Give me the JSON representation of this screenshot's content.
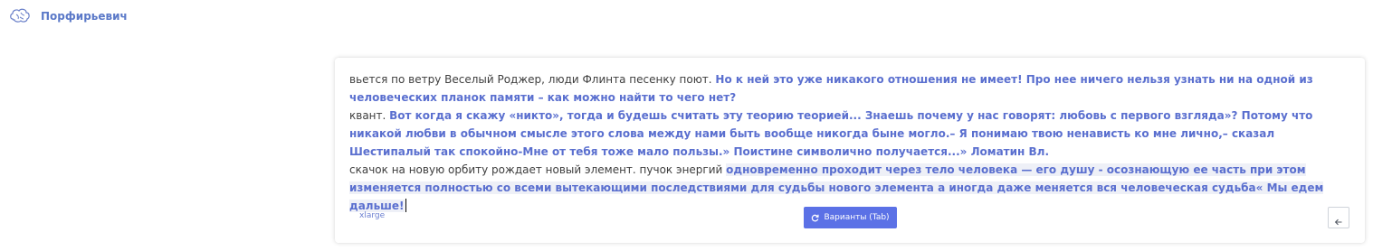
{
  "header": {
    "logo_icon": "brain-icon",
    "title": "Порфирьевич"
  },
  "editor": {
    "paragraphs": [
      {
        "prompt": "вьется по ветру Веселый Роджер, люди Флинта песенку поют. ",
        "generated": "Но к ней это уже никакого отношения не имеет! Про нее ничего нельзя узнать ни на одной из человеческих планок памяти – как можно найти то чего нет?"
      },
      {
        "prompt": "квант. ",
        "generated": "Вот когда я скажу «никто», тогда и будешь считать эту теорию теорией... Знаешь почему у нас говорят: любовь с первого взгляда»? Потому что никакой любви в обычном смысле этого слова между нами быть вообще никогда быне могло.– Я понимаю твою ненависть ко мне лично,– сказал Шестипалый так спокойно-Мне от тебя тоже мало пользы.» Поистине символично получается...» Ломатин Вл."
      },
      {
        "prompt": "скачок на новую орбиту рождает новый элемент. пучок энергий ",
        "generated": "одновременно проходит через тело человека — его душу - осознающую ее часть при этом изменяется полностью со всеми вытекающими последствиями для судьбы нового элемента а иногда даже меняется вся человеческая судьба« Мы едем дальше!"
      }
    ],
    "colors": {
      "generated_text": "#5a6fcf",
      "highlight_bg": "#eef0f7",
      "accent_button": "#5b71e6"
    }
  },
  "controls": {
    "size_label": "xlarge",
    "variants_button": {
      "icon": "refresh-icon",
      "label": "Варианты (Tab)"
    },
    "back_button": {
      "icon": "arrow-left-icon"
    }
  }
}
